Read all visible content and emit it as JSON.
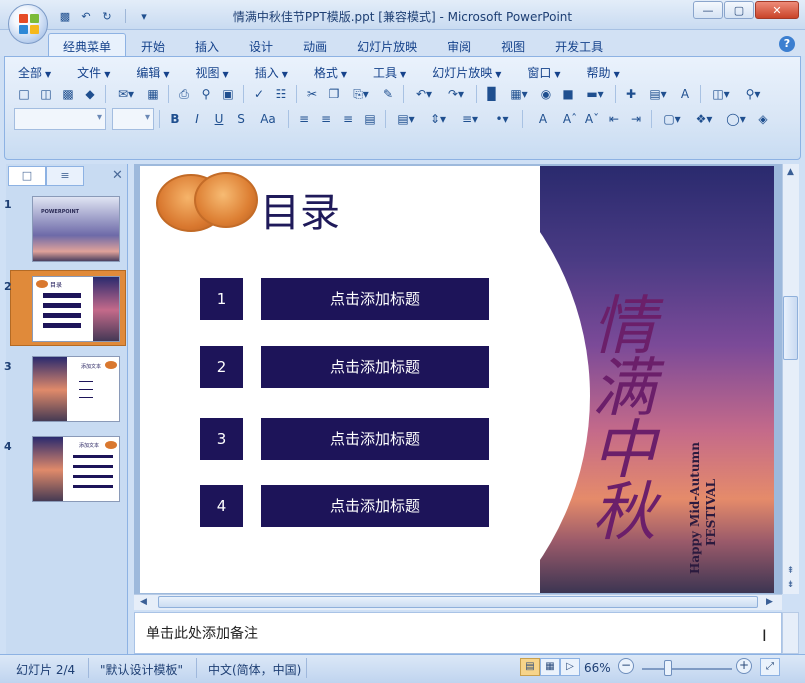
{
  "window": {
    "title": "情满中秋佳节PPT模版.ppt [兼容模式] - Microsoft PowerPoint",
    "controls": [
      "—",
      "▢",
      "✕"
    ]
  },
  "qat": {
    "save_icon": "save-icon",
    "undo_icon": "undo-icon",
    "redo_icon": "redo-icon",
    "customize_icon": "customize-qat-icon"
  },
  "ribbon_tabs": [
    "经典菜单",
    "开始",
    "插入",
    "设计",
    "动画",
    "幻灯片放映",
    "审阅",
    "视图",
    "开发工具"
  ],
  "active_tab": 0,
  "help_label": "?",
  "menus": [
    "全部",
    "文件",
    "编辑",
    "视图",
    "插入",
    "格式",
    "工具",
    "幻灯片放映",
    "窗口",
    "帮助"
  ],
  "toolbar": {
    "text_color_label": "A",
    "font_size_label": "Aa",
    "bold_label": "B",
    "italic_label": "I",
    "underline_label": "U",
    "strike_label": "S"
  },
  "left_panel": {
    "tabs": [
      "slides-tab",
      "outline-tab"
    ],
    "close_label": "✕",
    "thumbnails": [
      {
        "num": "1",
        "caption": "POWERPOINT"
      },
      {
        "num": "2",
        "caption": "目录"
      },
      {
        "num": "3",
        "caption": "添加文本"
      },
      {
        "num": "4",
        "caption": "添加文本"
      }
    ],
    "selected": 1
  },
  "slide": {
    "title": "目录",
    "toc": [
      {
        "num": "1",
        "label": "点击添加标题"
      },
      {
        "num": "2",
        "label": "点击添加标题"
      },
      {
        "num": "3",
        "label": "点击添加标题"
      },
      {
        "num": "4",
        "label": "点击添加标题"
      }
    ],
    "calligraphy": "情满中秋",
    "english_line1": "Happy Mid-Autumn",
    "english_line2": "FESTIVAL"
  },
  "notes": {
    "placeholder": "单击此处添加备注"
  },
  "status": {
    "slide_info": "幻灯片 2/4",
    "theme": "\"默认设计模板\"",
    "language": "中文(简体，中国)",
    "zoom": "66%",
    "minus": "−",
    "plus": "+"
  },
  "colors": {
    "toc_box": "#1d1459",
    "thumb_selected": "#e08a3a",
    "ribbon_bg": "#d9e6f6"
  }
}
